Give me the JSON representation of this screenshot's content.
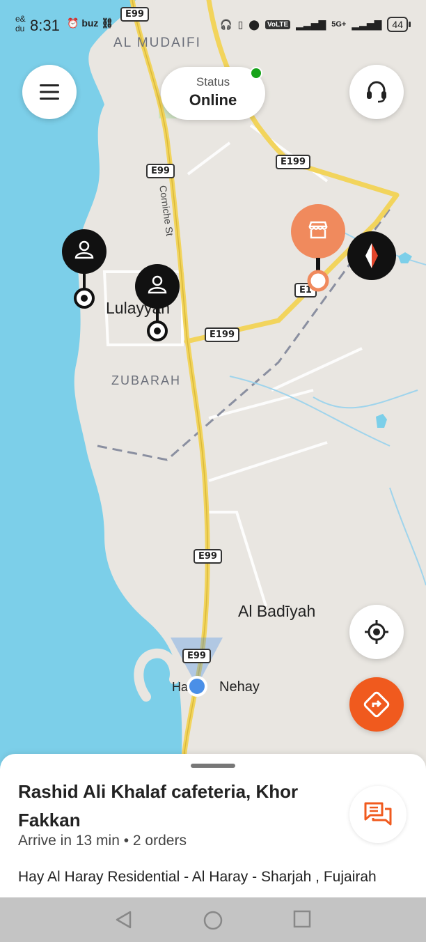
{
  "status_bar": {
    "carrier": "e&\ndu",
    "time": "8:31",
    "left_icons": "buz",
    "volte": "VoLTE",
    "volte_sub": "1 2",
    "network": "5G+",
    "battery": "44"
  },
  "map": {
    "labels": {
      "al_mudaifi": "AL MUDAIFI",
      "zubarah": "ZUBARAH",
      "lulayyah": "Lulayyah",
      "al_badiyah": "Al Badīyah",
      "nehay": "Nehay",
      "ha": "Ha",
      "corniche": "Corniche St"
    },
    "road_shields": {
      "e99_top": "E99",
      "e99_upper": "E99",
      "e199_top": "E199",
      "e199_mid": "E199",
      "e1_partial": "E1",
      "e99_lower": "E99",
      "e99_bottom": "E99"
    },
    "colors": {
      "water": "#7ccfe9",
      "land": "#e9e6e1",
      "highway": "#f2d45c",
      "accent": "#f05a1e",
      "store_pin": "#f08a5d",
      "my_location": "#4a8fe7"
    }
  },
  "header": {
    "menu_icon": "hamburger-menu-icon",
    "status_label": "Status",
    "status_value": "Online",
    "support_icon": "headset-icon"
  },
  "controls": {
    "compass_icon": "compass-icon",
    "locate_icon": "crosshair-icon",
    "navigate_icon": "navigate-diamond-icon"
  },
  "order": {
    "title": "Rashid Ali Khalaf cafeteria, Khor Fakkan",
    "subtitle": "Arrive in 13 min • 2 orders",
    "address": "Hay Al Haray Residential - Al Haray - Sharjah , Fujairah",
    "chat_icon": "chat-bubbles-icon"
  },
  "nav_bar": {
    "back_icon": "back-triangle-icon",
    "home_icon": "home-circle-icon",
    "recents_icon": "recents-square-icon"
  }
}
